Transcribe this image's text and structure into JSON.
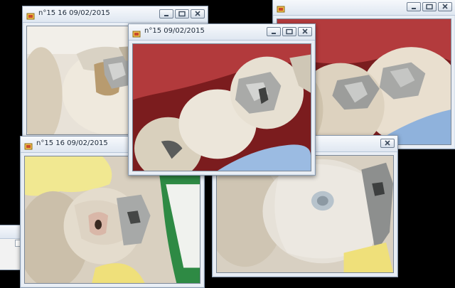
{
  "windows": [
    {
      "id": "win-top-left",
      "title": "n°15 16 09/02/2015"
    },
    {
      "id": "win-top-right",
      "title": ""
    },
    {
      "id": "win-bottom-left",
      "title": "n°15 16 09/02/2015"
    },
    {
      "id": "win-bottom-right",
      "title": ""
    },
    {
      "id": "win-center",
      "title": "n°15 09/02/2015"
    }
  ],
  "controls": {
    "minimize": "minimize-icon",
    "maximize": "maximize-icon",
    "close": "close-icon"
  },
  "colors": {
    "titlebar_top": "#f7f9fc",
    "titlebar_bottom": "#dfe7f1",
    "frame": "#8a9bb0",
    "desktop": "#000000"
  }
}
